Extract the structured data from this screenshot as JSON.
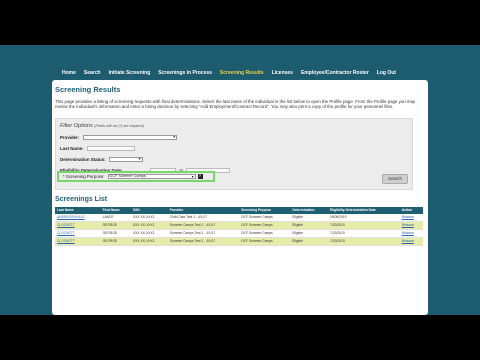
{
  "nav": {
    "items": [
      "Home",
      "Search",
      "Initiate Screening",
      "Screenings in Process",
      "Screening Results",
      "Licenses",
      "Employee/Contractor Roster",
      "Log Out"
    ],
    "active_index": 4
  },
  "page": {
    "title": "Screening Results",
    "intro": "This page provides a listing of screening requests with final determinations. Select the last name of the individual in the list below to open the Profile page. From the Profile page you may review the individual's information and enter a hiring decision by selecting \"Add Employment/Contract Record\". You may also print a copy of the profile for your personnel files."
  },
  "filter": {
    "title": "Filter Options",
    "required_note": "(Fields with an (*) are required)",
    "provider_label": "Provider:",
    "last_name_label": "Last Name:",
    "determination_status_label": "Determination Status:",
    "eligibility_date_label": "Eligibility Determination Date:",
    "date_to_label": "to",
    "purpose_label": "* Screening Purpose:",
    "purpose_value": "DCF Summer Camps",
    "help_icon_text": "?",
    "search_label": "Search"
  },
  "list": {
    "title": "Screenings List",
    "columns": [
      "Last Name",
      "First Name",
      "SSN",
      "Provider",
      "Screening Purpose",
      "Determination",
      "Eligibility Determination Date",
      "Action"
    ],
    "rows": [
      {
        "last": "ANDERSONVILLE",
        "first": "LANCE",
        "ssn": "XXX-XX-XXX1",
        "provider": "Child Care Test 1 - 4/1/17",
        "purpose": "DCF Summer Camps",
        "determination": "Eligible",
        "date": "09/09/2019",
        "action": "Release"
      },
      {
        "last": "CLOCKETT",
        "first": "GEORGE",
        "ssn": "XXX-XX-XXX1",
        "provider": "Summer Camps Test 1 - 4/1/17",
        "purpose": "DCF Summer Camps",
        "determination": "Eligible",
        "date": "7/23/2019",
        "action": "Release"
      },
      {
        "last": "CLOCKETT",
        "first": "GEORGE",
        "ssn": "XXX-XX-XXX1",
        "provider": "Summer Camps Test 1 - 4/1/17",
        "purpose": "DCF Summer Camps",
        "determination": "Eligible",
        "date": "7/23/2019",
        "action": "Release"
      },
      {
        "last": "CLOCKETT",
        "first": "GEORGE",
        "ssn": "XXX-XX-XXX1",
        "provider": "Summer Camps Test 1 - 4/1/17",
        "purpose": "DCF Summer Camps",
        "determination": "Eligible",
        "date": "7/23/2019",
        "action": "Release"
      }
    ]
  },
  "colors": {
    "teal_background": "#1d5b6e",
    "heading": "#1e5f74",
    "active_nav": "#e8d44a",
    "highlight_border": "#79d66a",
    "row_highlight": "#e7ebaa"
  }
}
